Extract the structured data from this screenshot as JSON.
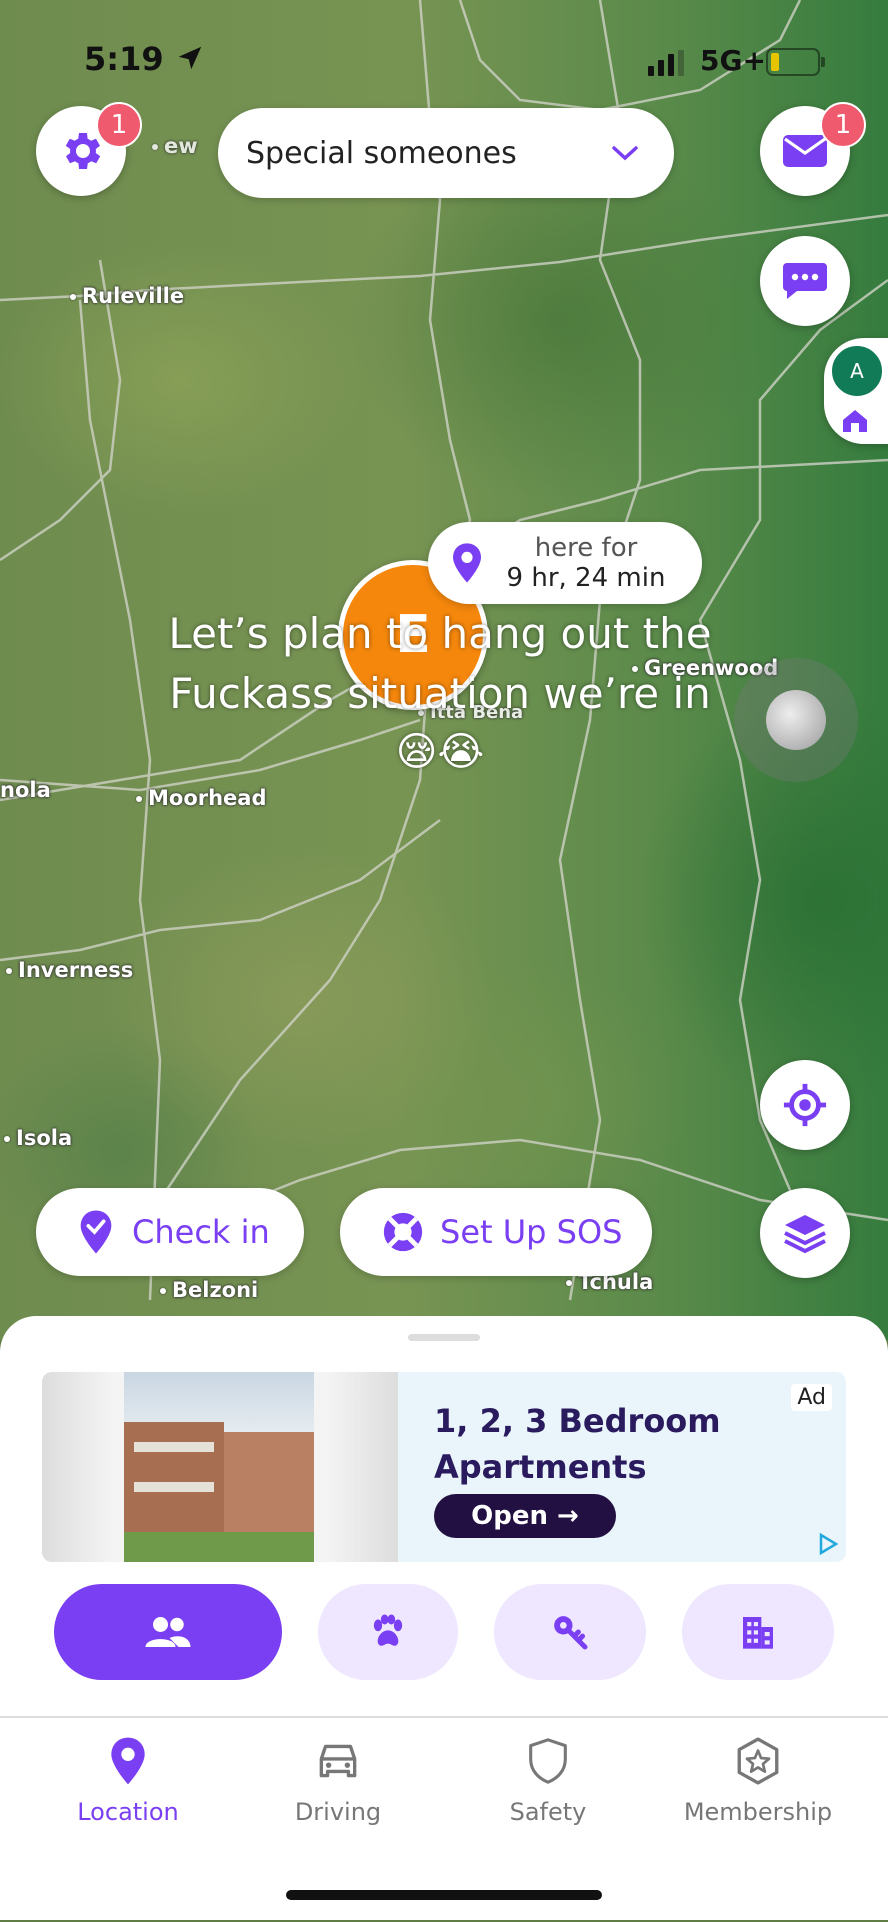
{
  "status_bar": {
    "time": "5:19",
    "network": "5G+"
  },
  "header": {
    "settings_badge": "1",
    "circle_selector": "Special someones",
    "messages_badge": "1",
    "side_avatar_initial": "A"
  },
  "map": {
    "places": [
      "Ruleville",
      "Moorhead",
      "Inverness",
      "Isola",
      "Belzoni",
      "Tchula",
      "Greenwood",
      "Itta Bena",
      "nola",
      "ew"
    ],
    "member_marker_initial": "E",
    "here_for_label": "here for",
    "here_for_duration": "9 hr, 24 min"
  },
  "overlay_caption": {
    "line1": "Let’s plan to hang out the",
    "line2": "Fuckass situation we’re in",
    "emoji": "😪😭"
  },
  "actions": {
    "check_in": "Check in",
    "sos": "Set Up SOS"
  },
  "ad": {
    "headline_line1": "1, 2, 3 Bedroom",
    "headline_line2": "Apartments",
    "cta": "Open →",
    "ad_label": "Ad"
  },
  "tabs": [
    {
      "icon": "people-icon",
      "active": true
    },
    {
      "icon": "paw-icon",
      "active": false
    },
    {
      "icon": "key-icon",
      "active": false
    },
    {
      "icon": "building-icon",
      "active": false
    }
  ],
  "bottom_nav": [
    {
      "label": "Location",
      "icon": "location-pin-icon",
      "active": true
    },
    {
      "label": "Driving",
      "icon": "car-icon",
      "active": false
    },
    {
      "label": "Safety",
      "icon": "shield-icon",
      "active": false
    },
    {
      "label": "Membership",
      "icon": "star-badge-icon",
      "active": false
    }
  ],
  "colors": {
    "accent": "#7a3ff2",
    "accent_light": "#efe6ff",
    "badge": "#f05a6e",
    "marker": "#f5870c"
  }
}
